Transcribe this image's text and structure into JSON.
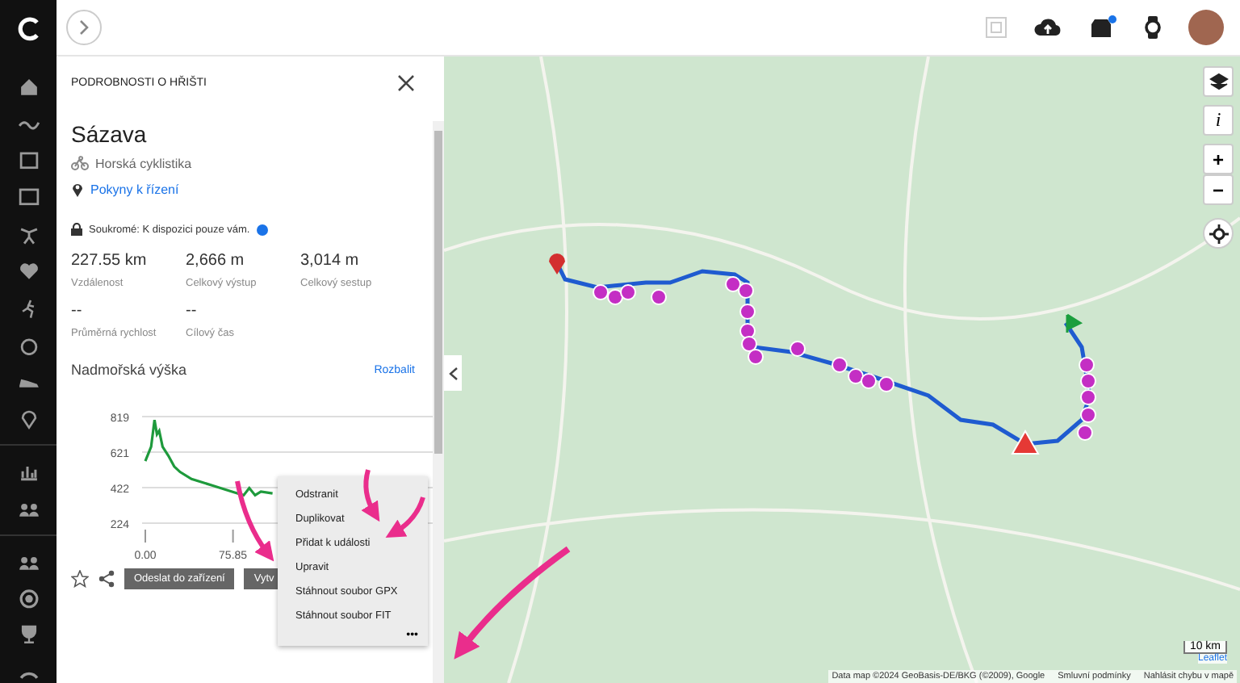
{
  "panel": {
    "header": "PODROBNOSTI O HŘIŠTI",
    "title": "Sázava",
    "sport": "Horská cyklistika",
    "directions_link": "Pokyny k řízení",
    "privacy": "Soukromé: K dispozici pouze vám.",
    "stats": [
      {
        "value": "227.55 km",
        "label": "Vzdálenost"
      },
      {
        "value": "2,666 m",
        "label": "Celkový výstup"
      },
      {
        "value": "3,014 m",
        "label": "Celkový sestup"
      },
      {
        "value": "--",
        "label": "Průměrná rychlost"
      },
      {
        "value": "--",
        "label": "Cílový čas"
      }
    ],
    "elevation": {
      "heading": "Nadmořská výška",
      "expand_link": "Rozbalit",
      "chart_data": {
        "type": "line",
        "xlim": [
          0,
          250
        ],
        "ylim": [
          224,
          819
        ],
        "x": [
          0,
          5,
          8,
          10,
          12,
          15,
          20,
          25,
          30,
          40,
          50,
          60,
          70,
          75,
          80,
          85,
          90,
          95,
          100,
          110
        ],
        "yticks": [
          224,
          422,
          621,
          819
        ],
        "xticks": [
          {
            "value": 0,
            "label": "0.00"
          },
          {
            "value": 75.85,
            "label": "75.85"
          }
        ],
        "series": [
          {
            "color": "#1e9a3c",
            "values": [
              570,
              650,
              800,
              720,
              740,
              650,
              600,
              540,
              510,
              470,
              450,
              430,
              410,
              400,
              390,
              380,
              420,
              380,
              400,
              390
            ]
          }
        ]
      }
    },
    "actions": [
      "Odeslat do zařízení",
      "Vytv"
    ],
    "menu": [
      "Odstranit",
      "Duplikovat",
      "Přidat k události",
      "Upravit",
      "Stáhnout soubor GPX",
      "Stáhnout soubor FIT"
    ],
    "more": "•••"
  },
  "map": {
    "scale": "10 km",
    "leaflet": "Leaflet",
    "attribution": "Data map ©2024 GeoBasis-DE/BKG (©2009), Google",
    "terms": "Smluvní podmínky",
    "report": "Nahlásit chybu v mapě",
    "info": "i",
    "zoom_in": "+",
    "zoom_out": "−",
    "notifications": true
  }
}
